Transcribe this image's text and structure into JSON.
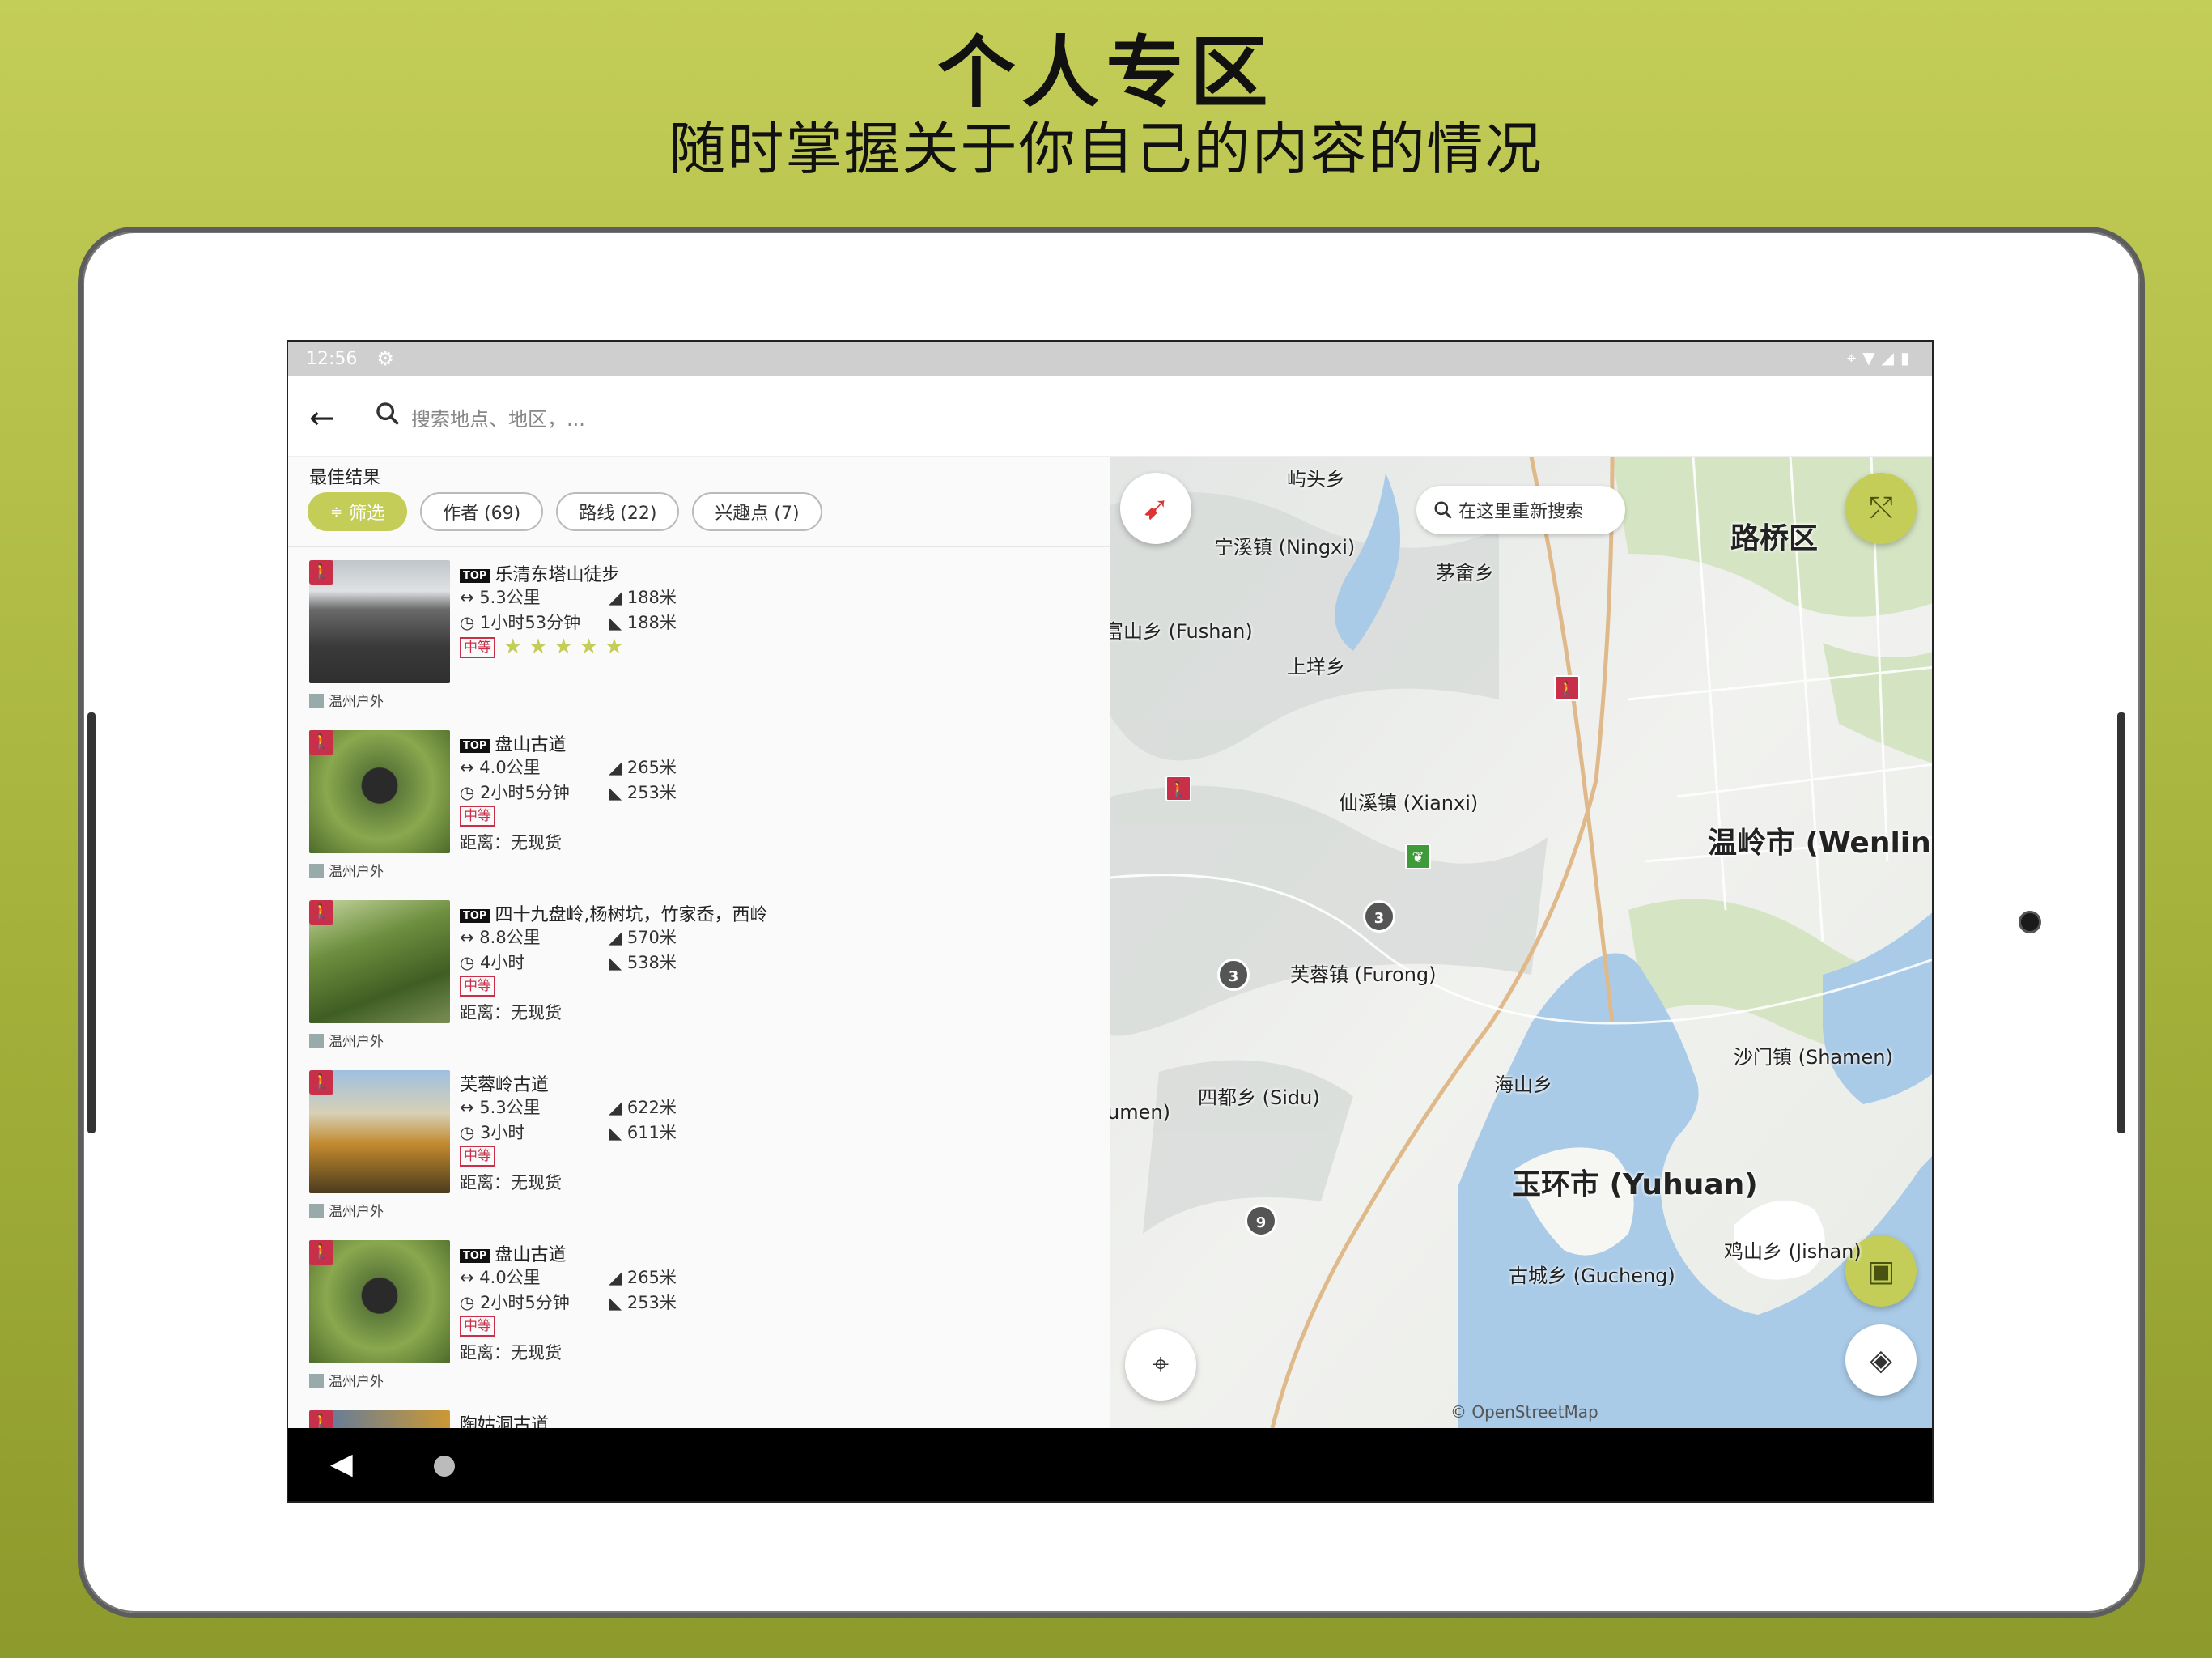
{
  "promo": {
    "title": "个人专区",
    "subtitle": "随时掌握关于你自己的内容的情况"
  },
  "status": {
    "time": "12:56"
  },
  "search": {
    "placeholder": "搜索地点、地区，..."
  },
  "results": {
    "header": "最佳结果",
    "chips": [
      {
        "label": "筛选",
        "active": true
      },
      {
        "label": "作者 (69)"
      },
      {
        "label": "路线 (22)"
      },
      {
        "label": "兴趣点 (7)"
      }
    ],
    "items": [
      {
        "top": true,
        "title": "乐清东塔山徒步",
        "distance": "5.3公里",
        "ascent": "188米",
        "duration": "1小时53分钟",
        "descent": "188米",
        "difficulty": "中等",
        "rating_stars": 5,
        "author": "温州户外"
      },
      {
        "top": true,
        "title": "盘山古道",
        "distance": "4.0公里",
        "ascent": "265米",
        "duration": "2小时5分钟",
        "descent": "253米",
        "difficulty": "中等",
        "extra": "距离：无现货",
        "author": "温州户外"
      },
      {
        "top": true,
        "title": "四十九盘岭,杨树坑，竹家岙，西岭",
        "distance": "8.8公里",
        "ascent": "570米",
        "duration": "4小时",
        "descent": "538米",
        "difficulty": "中等",
        "extra": "距离：无现货",
        "author": "温州户外"
      },
      {
        "top": false,
        "title": "芙蓉岭古道",
        "distance": "5.3公里",
        "ascent": "622米",
        "duration": "3小时",
        "descent": "611米",
        "difficulty": "中等",
        "extra": "距离：无现货",
        "author": "温州户外"
      },
      {
        "top": true,
        "title": "盘山古道",
        "distance": "4.0公里",
        "ascent": "265米",
        "duration": "2小时5分钟",
        "descent": "253米",
        "difficulty": "中等",
        "extra": "距离：无现货",
        "author": "温州户外"
      },
      {
        "top": false,
        "title": "陶姑洞古道"
      }
    ]
  },
  "map": {
    "research_button": "在这里重新搜索",
    "attribution": "© OpenStreetMap",
    "labels": {
      "l1": "屿头乡",
      "l2": "宁溪镇 (Ningxi)",
      "l3": "茅畲乡",
      "l4": "富山乡 (Fushan)",
      "l5": "上垟乡",
      "l6": "仙溪镇 (Xianxi)",
      "l7": "芙蓉镇 (Furong)",
      "l8": "四都乡 (Sidu)",
      "l9": "umen)",
      "l10": "海山乡",
      "l11": "沙门镇 (Shamen)",
      "l12": "鸡山乡 (Jishan)",
      "l13": "古城乡 (Gucheng)",
      "city1": "路桥区",
      "city2": "温岭市 (Wenling)",
      "city3": "玉环市 (Yuhuan)"
    },
    "clusters": {
      "c1": "3",
      "c2": "3",
      "c3": "9"
    }
  },
  "colors": {
    "accent": "#c3cd58",
    "hike": "#c8304a",
    "water": "#a9cbe8"
  }
}
